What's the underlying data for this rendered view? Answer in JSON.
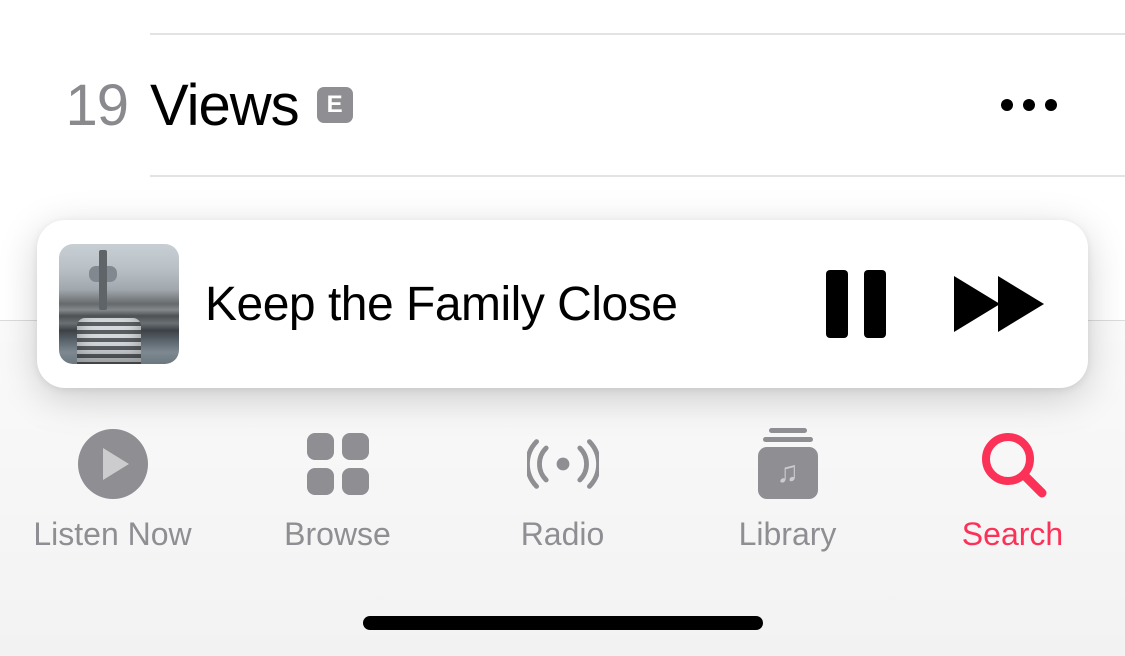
{
  "colors": {
    "accent": "#fc3158",
    "inactive": "#8e8e93"
  },
  "track_row": {
    "number": "19",
    "title": "Views",
    "explicit_label": "E"
  },
  "now_playing": {
    "title": "Keep the Family Close"
  },
  "tabs": {
    "listen_now": "Listen Now",
    "browse": "Browse",
    "radio": "Radio",
    "library": "Library",
    "search": "Search",
    "active": "search"
  }
}
